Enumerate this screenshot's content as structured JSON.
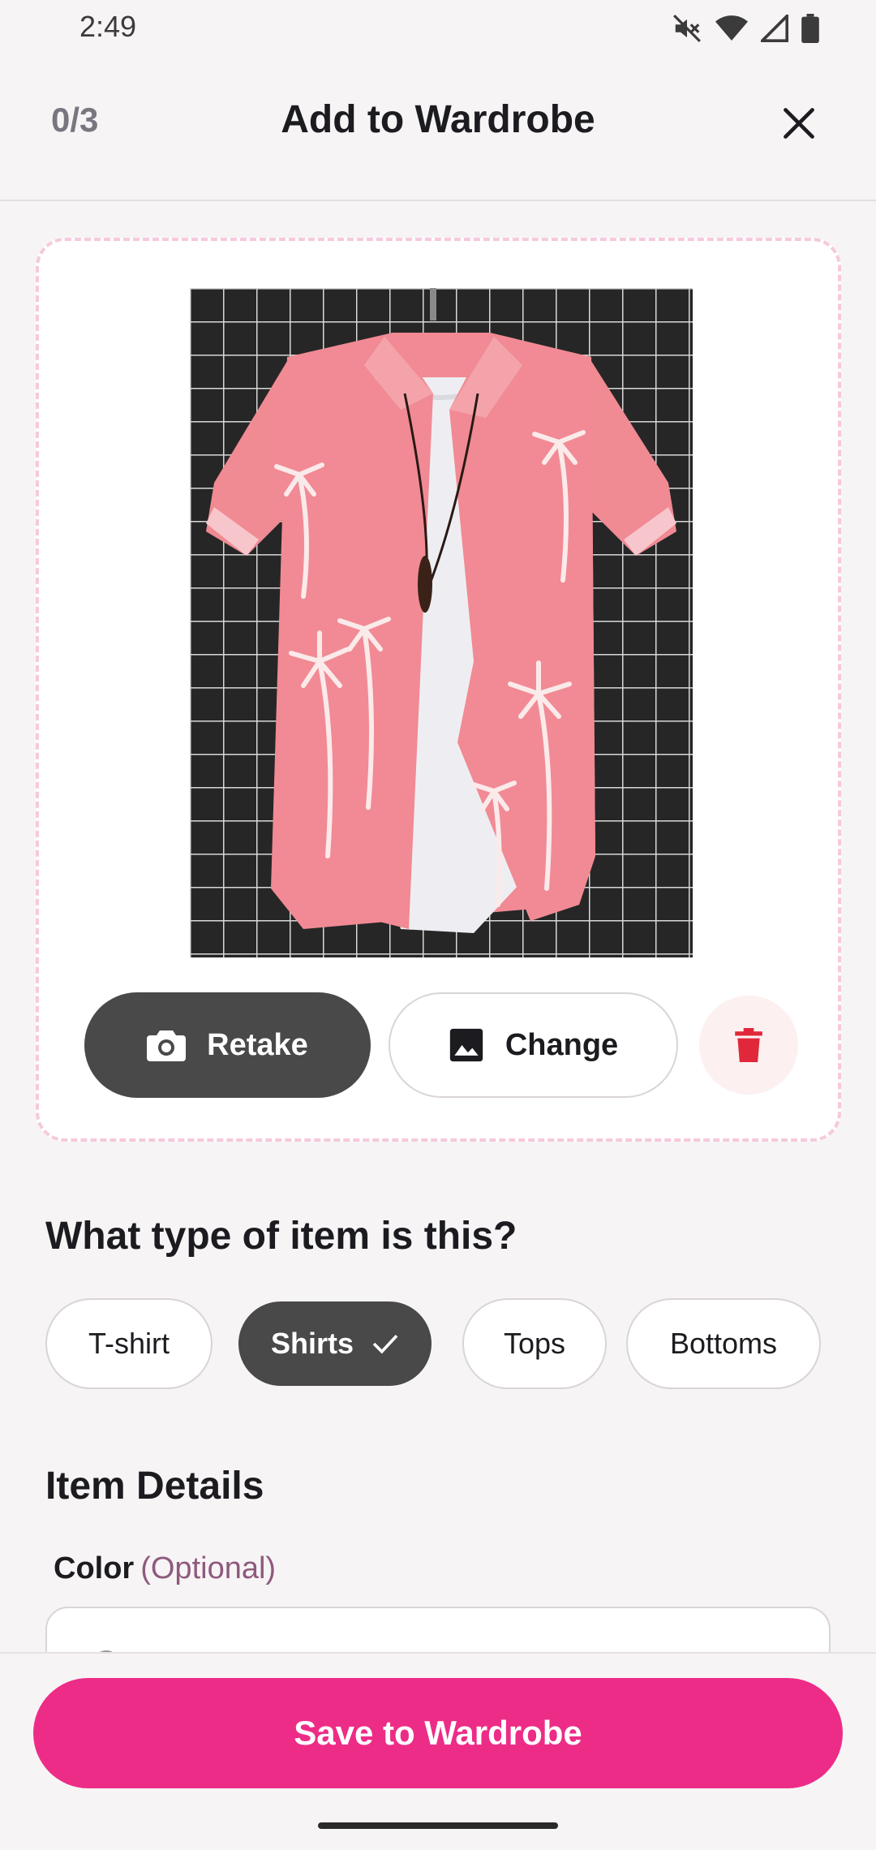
{
  "status_bar": {
    "time": "2:49",
    "icons": [
      "mute-icon",
      "wifi-icon",
      "signal-icon",
      "battery-icon"
    ]
  },
  "header": {
    "counter": "0/3",
    "title": "Add to Wardrobe",
    "close_icon": "close-icon"
  },
  "photo_card": {
    "image_description": "pink palm print short-sleeve shirt on hanger over white tee",
    "retake_label": "Retake",
    "change_label": "Change",
    "delete_icon": "trash-icon"
  },
  "item_type": {
    "question": "What type of item is this?",
    "options": [
      {
        "label": "T-shirt",
        "selected": false
      },
      {
        "label": "Shirts",
        "selected": true
      },
      {
        "label": "Tops",
        "selected": false
      },
      {
        "label": "Bottoms",
        "selected": false
      }
    ]
  },
  "details": {
    "title": "Item Details",
    "color_label": "Color",
    "color_optional": "(Optional)"
  },
  "footer": {
    "save_label": "Save to Wardrobe"
  },
  "colors": {
    "accent": "#ed2c87",
    "dark_button": "#494949",
    "delete": "#e0283a",
    "card_border": "#f6c9dc"
  }
}
